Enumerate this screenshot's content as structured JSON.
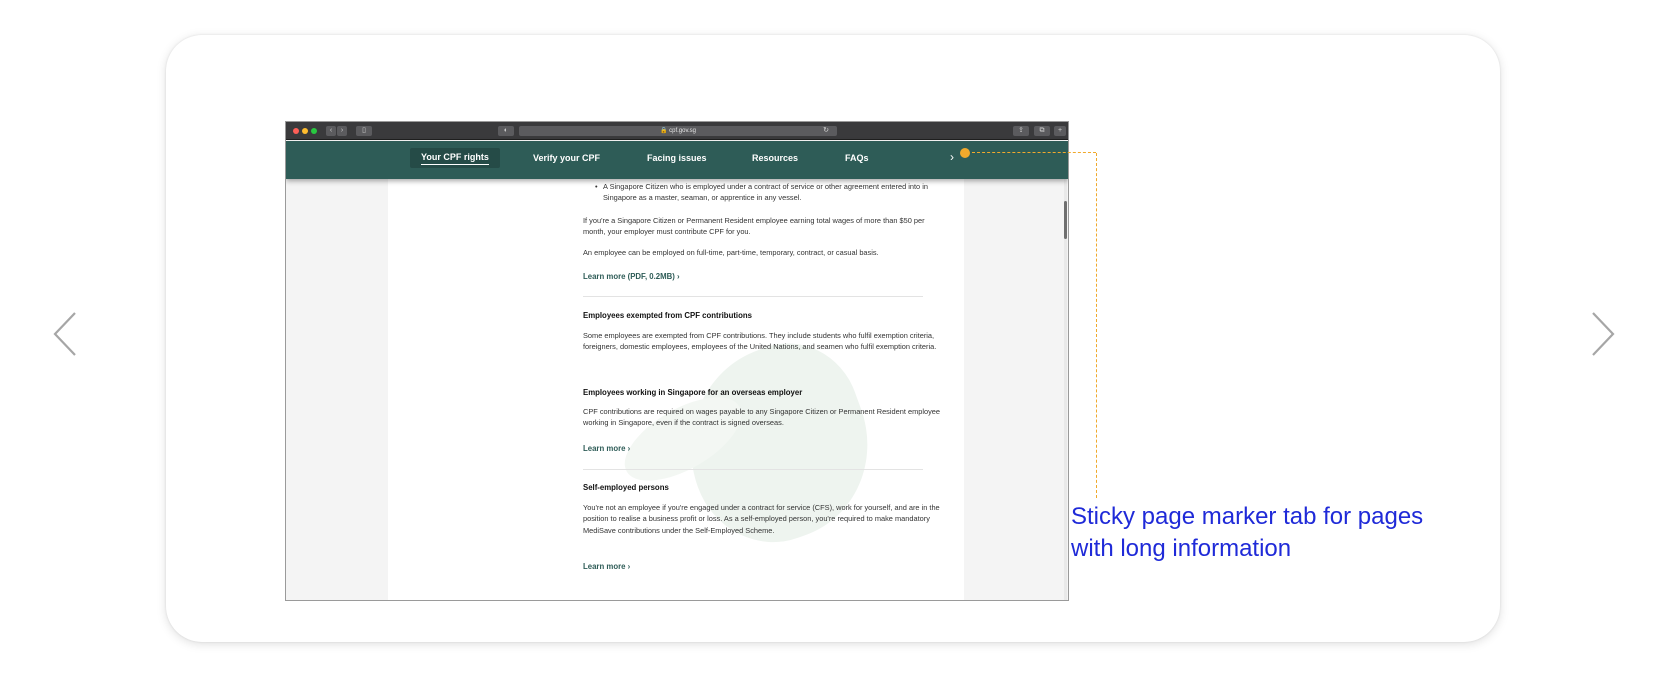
{
  "carousel": {
    "prev_icon": "chevron-left-icon",
    "next_icon": "chevron-right-icon"
  },
  "browser": {
    "address": "🔒 cpf.gov.sg",
    "reload_icon": "↻"
  },
  "site_nav": {
    "items": [
      "Your CPF rights",
      "Verify your CPF",
      "Facing issues",
      "Resources",
      "FAQs"
    ],
    "active_index": 0,
    "more_label": "›"
  },
  "content": {
    "bullet_text": "A Singapore Citizen who is employed under a contract of service or other agreement entered into in Singapore as a master, seaman, or apprentice in any vessel.",
    "para1": "If you're a Singapore Citizen or Permanent Resident employee earning total wages of more than $50 per month, your employer must contribute CPF for you.",
    "para2": "An employee can be employed on full-time, part-time, temporary, contract, or casual basis.",
    "link1": "Learn more (PDF, 0.2MB)  ›",
    "heading1": "Employees exempted from CPF contributions",
    "para3": "Some employees are exempted from CPF contributions. They include students who fulfil exemption criteria, foreigners, domestic employees, employees of the United Nations, and seamen who fulfil exemption criteria.",
    "heading2": "Employees working in Singapore for an overseas employer",
    "para4": "CPF contributions are required on wages payable to any Singapore Citizen or Permanent Resident employee working in Singapore, even if the contract is signed overseas.",
    "link2": "Learn more  ›",
    "heading3": "Self-employed persons",
    "para5": "You're not an employee if you're engaged under a contract for service (CFS), work for yourself, and are in the position to realise a business profit or loss. As a self-employed person, you're required to make mandatory MediSave contributions under the Self-Employed Scheme.",
    "link3": "Learn more  ›"
  },
  "annotation": {
    "text": "Sticky page marker tab for pages with long information",
    "color": "#1f2ad8",
    "marker_color": "#f0a92c"
  },
  "colors": {
    "nav_bg": "#2e5c57",
    "link": "#2e5c57"
  }
}
